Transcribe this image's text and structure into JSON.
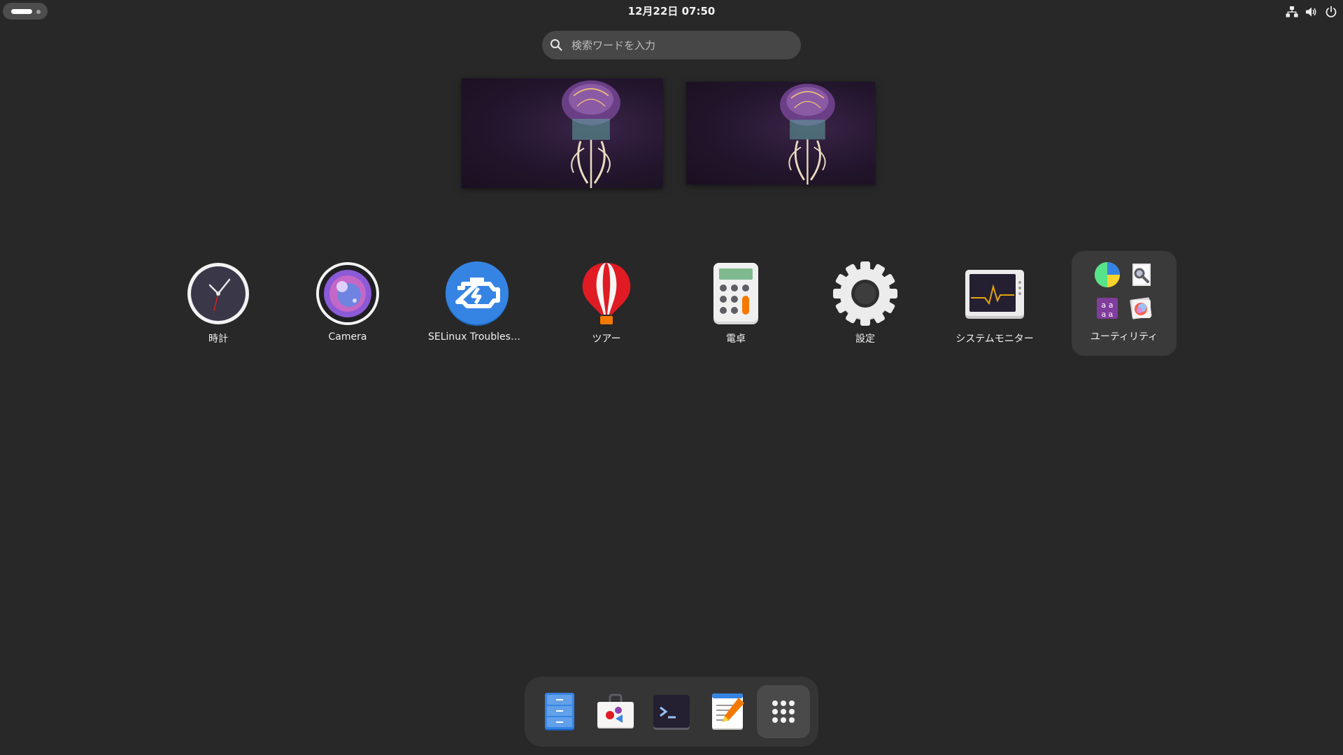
{
  "topbar": {
    "clock": "12月22日  07:50",
    "tray_icons": [
      "network-icon",
      "volume-icon",
      "power-icon"
    ]
  },
  "search": {
    "placeholder": "検索ワードを入力",
    "value": ""
  },
  "workspaces": [
    {
      "name": "workspace-1",
      "active": true
    },
    {
      "name": "workspace-2",
      "active": false
    }
  ],
  "apps": [
    {
      "label": "時計",
      "icon": "clock-icon"
    },
    {
      "label": "Camera",
      "icon": "camera-icon"
    },
    {
      "label": "SELinux Troubleshooter",
      "icon": "selinux-troubleshooter-icon"
    },
    {
      "label": "ツアー",
      "icon": "tour-balloon-icon"
    },
    {
      "label": "電卓",
      "icon": "calculator-icon"
    },
    {
      "label": "設定",
      "icon": "settings-gear-icon"
    },
    {
      "label": "システムモニター",
      "icon": "system-monitor-icon"
    },
    {
      "label": "ユーティリティ",
      "icon": "utilities-folder-icon"
    }
  ],
  "dash": [
    {
      "name": "files",
      "icon": "files-icon"
    },
    {
      "name": "software",
      "icon": "software-store-icon"
    },
    {
      "name": "terminal",
      "icon": "terminal-icon"
    },
    {
      "name": "text-editor",
      "icon": "text-editor-icon"
    },
    {
      "name": "show-apps",
      "icon": "app-grid-icon"
    }
  ],
  "colors": {
    "background": "#282828",
    "search_bg": "#474747",
    "folder_bg": "#3a3a3a",
    "dash_bg": "#353535",
    "accent_blue": "#3584e4"
  }
}
